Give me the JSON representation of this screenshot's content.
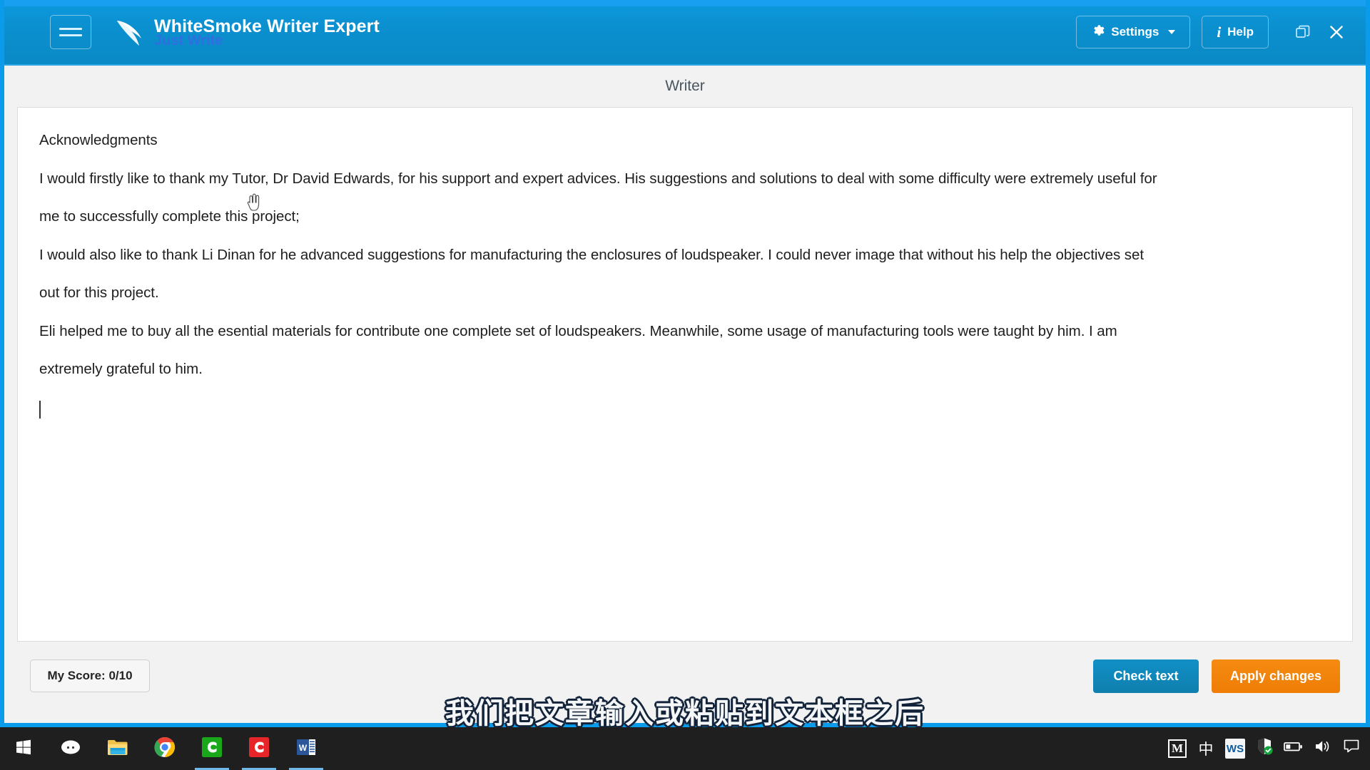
{
  "titlebar": {
    "menu_icon": "hamburger-icon",
    "logo_icon": "feather-quill-icon",
    "brand_title": "WhiteSmoke Writer Expert",
    "brand_subtitle": "Just Write",
    "settings_label": "Settings",
    "settings_icon": "gear-icon",
    "help_label": "Help",
    "help_icon": "info-icon",
    "restore_icon": "restore-window-icon",
    "close_icon": "close-icon",
    "bg_color": "#0b8fce",
    "accent_color": "#189ff2"
  },
  "subheader": {
    "title": "Writer"
  },
  "editor": {
    "lines": [
      "Acknowledgments",
      "I would firstly like to thank my Tutor, Dr David Edwards, for his support and expert advices. His suggestions and solutions to deal with some difficulty were extremely useful for",
      "me to successfully complete this project;",
      "I would also like to thank Li Dinan for he advanced suggestions for manufacturing the enclosures of loudspeaker. I could never image that without his help the objectives set",
      "out for this project.",
      "Eli helped me to buy all the esential materials for contribute one complete set of loudspeakers. Meanwhile, some usage of manufacturing tools were taught by him. I am",
      "extremely grateful to him."
    ],
    "cursor_icon": "hand-pointer-cursor",
    "text_caret": "text-caret"
  },
  "footer": {
    "score_label": "My Score: 0/10",
    "check_text_label": "Check text",
    "apply_changes_label": "Apply changes",
    "check_text_color": "#0f82b2",
    "apply_changes_color": "#ef7f07"
  },
  "subtitle": {
    "text": "我们把文章输入或粘贴到文本框之后"
  },
  "taskbar": {
    "items": [
      {
        "name": "start-button",
        "icon": "windows-logo-icon"
      },
      {
        "name": "taskbar-item-oval",
        "icon": "oval-face-icon"
      },
      {
        "name": "taskbar-item-file-explorer",
        "icon": "folder-icon"
      },
      {
        "name": "taskbar-item-chrome",
        "icon": "chrome-icon"
      },
      {
        "name": "taskbar-item-camtasia-editor",
        "icon": "camtasia-green-icon"
      },
      {
        "name": "taskbar-item-camtasia-recorder",
        "icon": "camtasia-red-icon"
      },
      {
        "name": "taskbar-item-word",
        "icon": "word-icon"
      }
    ],
    "tray": [
      {
        "name": "tray-item-m",
        "icon": "letter-m-icon",
        "label": "M"
      },
      {
        "name": "tray-item-ime",
        "icon": "chinese-ime-icon",
        "label": "中"
      },
      {
        "name": "tray-item-whitesmoke",
        "icon": "whitesmoke-icon",
        "label": "WS"
      },
      {
        "name": "tray-item-defender",
        "icon": "shield-check-icon",
        "label": ""
      },
      {
        "name": "tray-item-battery",
        "icon": "battery-icon",
        "label": ""
      },
      {
        "name": "tray-item-volume",
        "icon": "speaker-icon",
        "label": ""
      },
      {
        "name": "tray-item-action-center",
        "icon": "notification-icon",
        "label": ""
      }
    ]
  }
}
